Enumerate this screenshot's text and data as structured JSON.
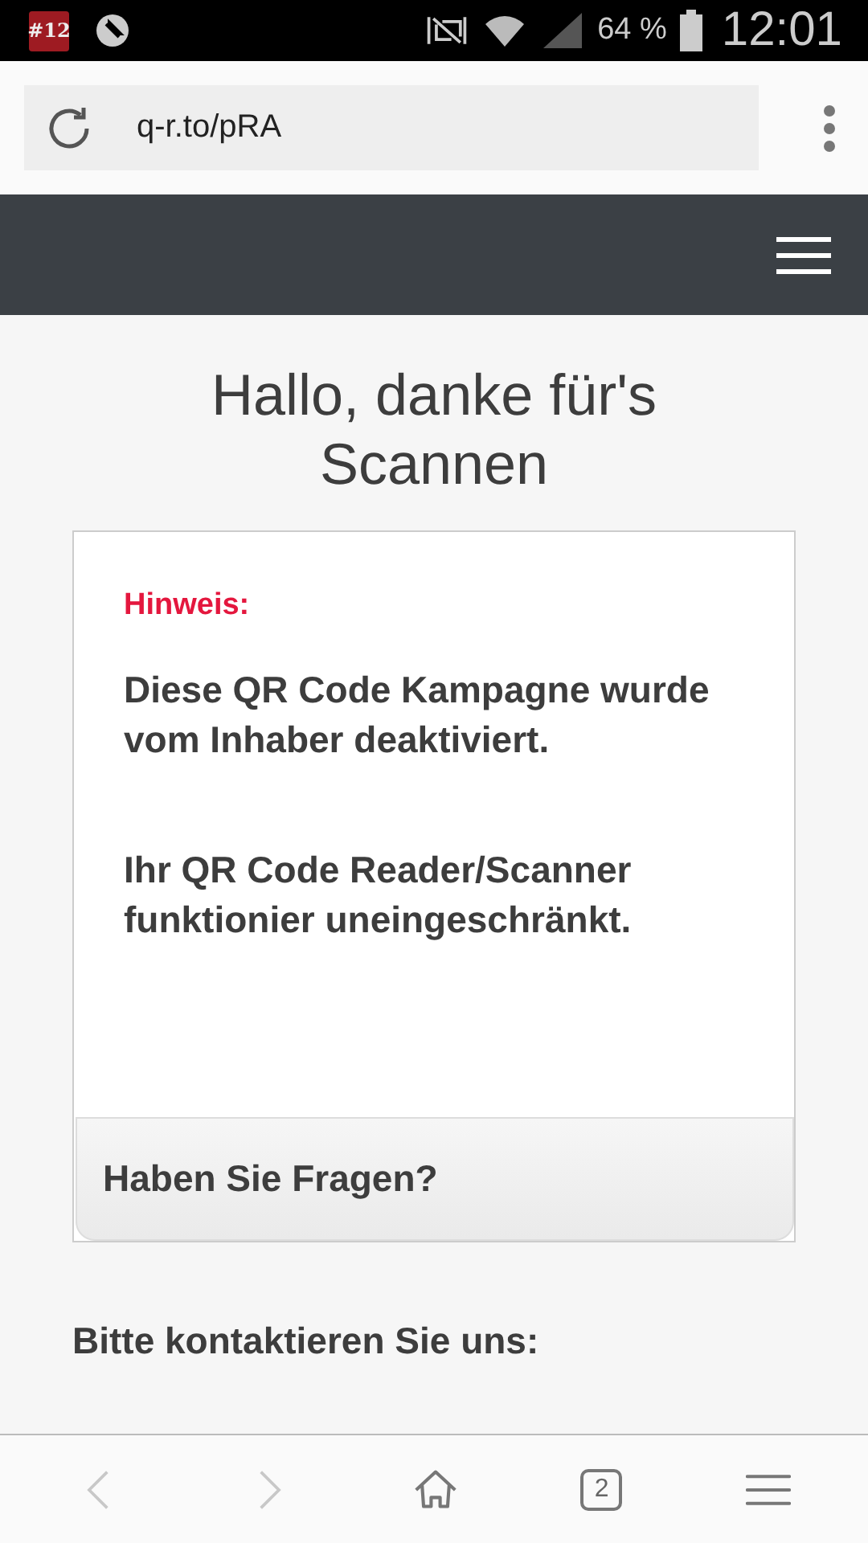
{
  "status_bar": {
    "notification_badge": "#12",
    "battery": "64 %",
    "time": "12:01"
  },
  "browser": {
    "url": "q-r.to/pRA"
  },
  "page": {
    "title": "Hallo, danke für's Scannen",
    "card": {
      "label": "Hinweis:",
      "paragraphs": [
        "Diese QR Code Kampagne wurde vom Inhaber deaktiviert.",
        "Ihr QR Code Reader/Scanner funktionier uneingeschränkt."
      ],
      "footer": "Haben Sie Fragen?"
    },
    "contact": "Bitte kontaktieren Sie uns:"
  },
  "bottom_nav": [
    {
      "kind": "back",
      "disabled": true
    },
    {
      "kind": "forward",
      "disabled": true
    },
    {
      "kind": "home",
      "disabled": false
    },
    {
      "kind": "tabs",
      "label": "2",
      "disabled": false
    },
    {
      "kind": "menu",
      "disabled": false
    }
  ]
}
